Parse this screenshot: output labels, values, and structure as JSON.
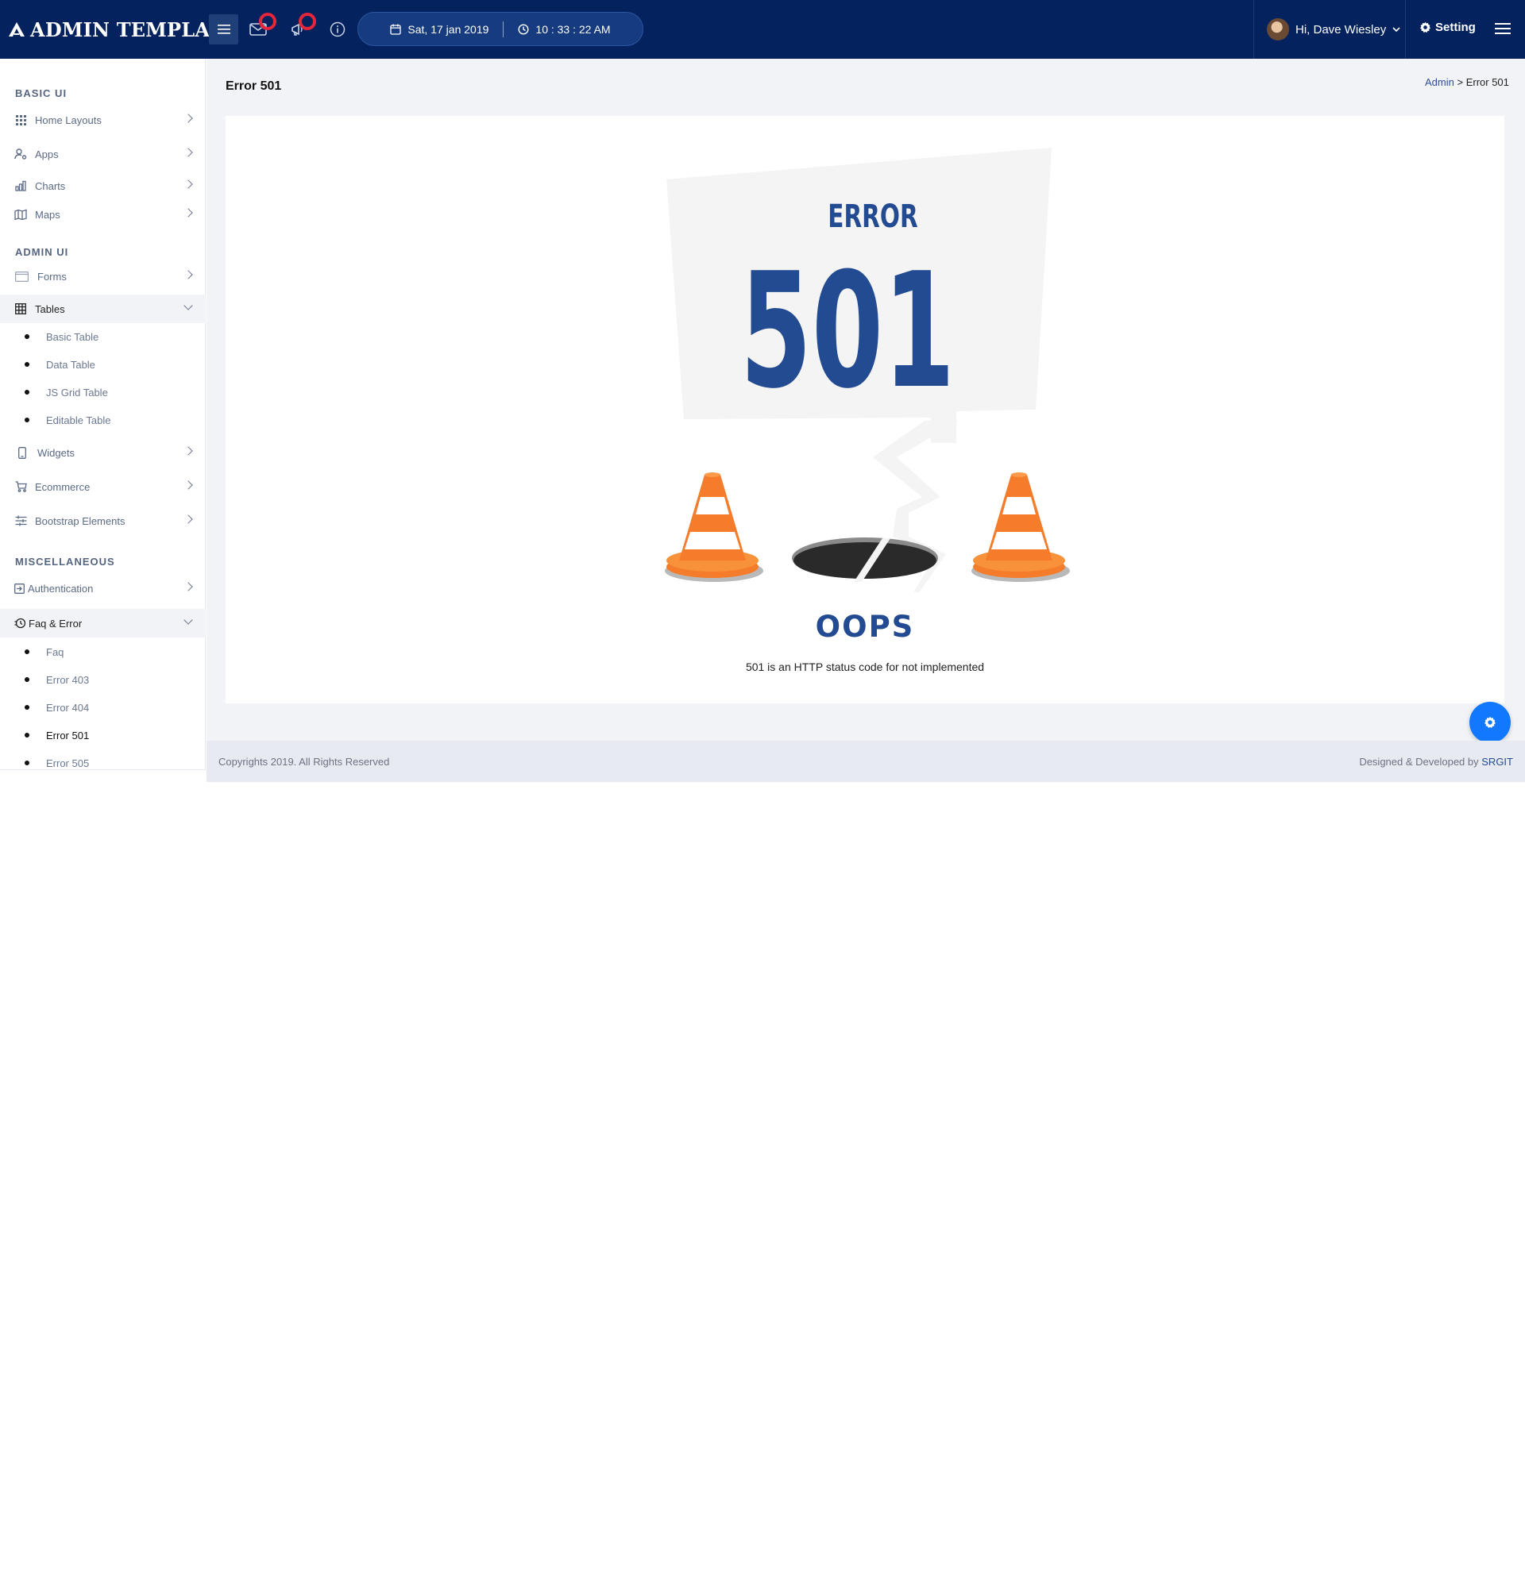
{
  "brand": {
    "name": "ADMIN TEMPLATE"
  },
  "header": {
    "date": "Sat, 17 jan 2019",
    "time": "10 : 33 : 22 AM",
    "user_greeting": "Hi, Dave Wiesley",
    "setting_label": "Setting"
  },
  "sidebar": {
    "sections": [
      {
        "title": "BASIC UI"
      },
      {
        "title": "ADMIN UI"
      },
      {
        "title": "MISCELLANEOUS"
      }
    ],
    "items": [
      {
        "label": "Home Layouts",
        "icon": "grid-icon"
      },
      {
        "label": "Apps",
        "icon": "user-gear-icon"
      },
      {
        "label": "Charts",
        "icon": "bar-chart-icon"
      },
      {
        "label": "Maps",
        "icon": "map-icon"
      },
      {
        "label": "Forms",
        "icon": "form-icon"
      },
      {
        "label": "Tables",
        "icon": "table-icon"
      },
      {
        "label": "Widgets",
        "icon": "phone-icon"
      },
      {
        "label": "Ecommerce",
        "icon": "cart-icon"
      },
      {
        "label": "Bootstrap Elements",
        "icon": "sliders-icon"
      },
      {
        "label": "Authentication",
        "icon": "login-icon"
      },
      {
        "label": "Faq & Error",
        "icon": "history-icon"
      }
    ],
    "tables_sub": [
      "Basic Table",
      "Data Table",
      "JS Grid Table",
      "Editable Table"
    ],
    "faq_sub": [
      "Faq",
      "Error 403",
      "Error 404",
      "Error 501",
      "Error 505"
    ]
  },
  "main": {
    "page_title": "Error 501",
    "breadcrumb": {
      "parent": "Admin",
      "separator": ">",
      "current": "Error 501"
    },
    "error": {
      "word": "ERROR",
      "code": "501",
      "headline": "OOPS",
      "message": "501 is an HTTP status code for not implemented"
    }
  },
  "footer": {
    "copyright": "Copyrights 2019. All Rights Reserved",
    "credit_prefix": "Designed & Developed by",
    "credit_link": "SRGIT"
  },
  "colors": {
    "topbar": "#04225e",
    "accent_blue": "#234b91",
    "fab": "#1178ff",
    "cone_orange": "#f47c2b",
    "badge_red": "#e5263b"
  }
}
